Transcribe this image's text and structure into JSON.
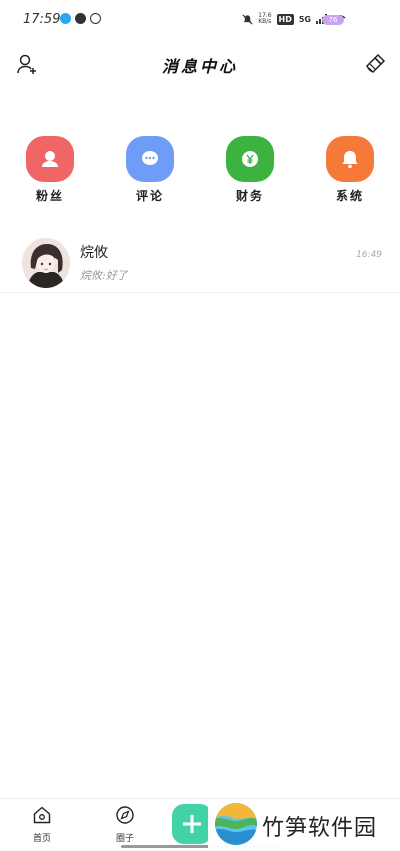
{
  "status_bar": {
    "time": "17:59",
    "network_speed_value": "17.6",
    "network_speed_unit": "KB/s",
    "hd_label": "HD",
    "network_type": "5G",
    "battery_label": "76"
  },
  "header": {
    "title": "消息中心",
    "left_icon": "add-user-icon",
    "right_icon": "clear-broom-icon"
  },
  "categories": [
    {
      "label": "粉丝",
      "color": "#f06565",
      "icon": "person-icon"
    },
    {
      "label": "评论",
      "color": "#6f9cf7",
      "icon": "chat-bubble-icon"
    },
    {
      "label": "财务",
      "color": "#3cb33f",
      "icon": "yen-icon"
    },
    {
      "label": "系统",
      "color": "#f57a3a",
      "icon": "bell-icon"
    }
  ],
  "messages": [
    {
      "name": "烷攸",
      "preview": "烷攸:好了",
      "time": "16:49"
    }
  ],
  "bottom_nav": {
    "items": [
      {
        "label": "首页",
        "icon": "home-icon"
      },
      {
        "label": "圈子",
        "icon": "compass-icon"
      }
    ],
    "center_icon": "plus-icon",
    "accent_color": "#44d2a8"
  },
  "watermark": {
    "text": "竹笋软件园"
  }
}
